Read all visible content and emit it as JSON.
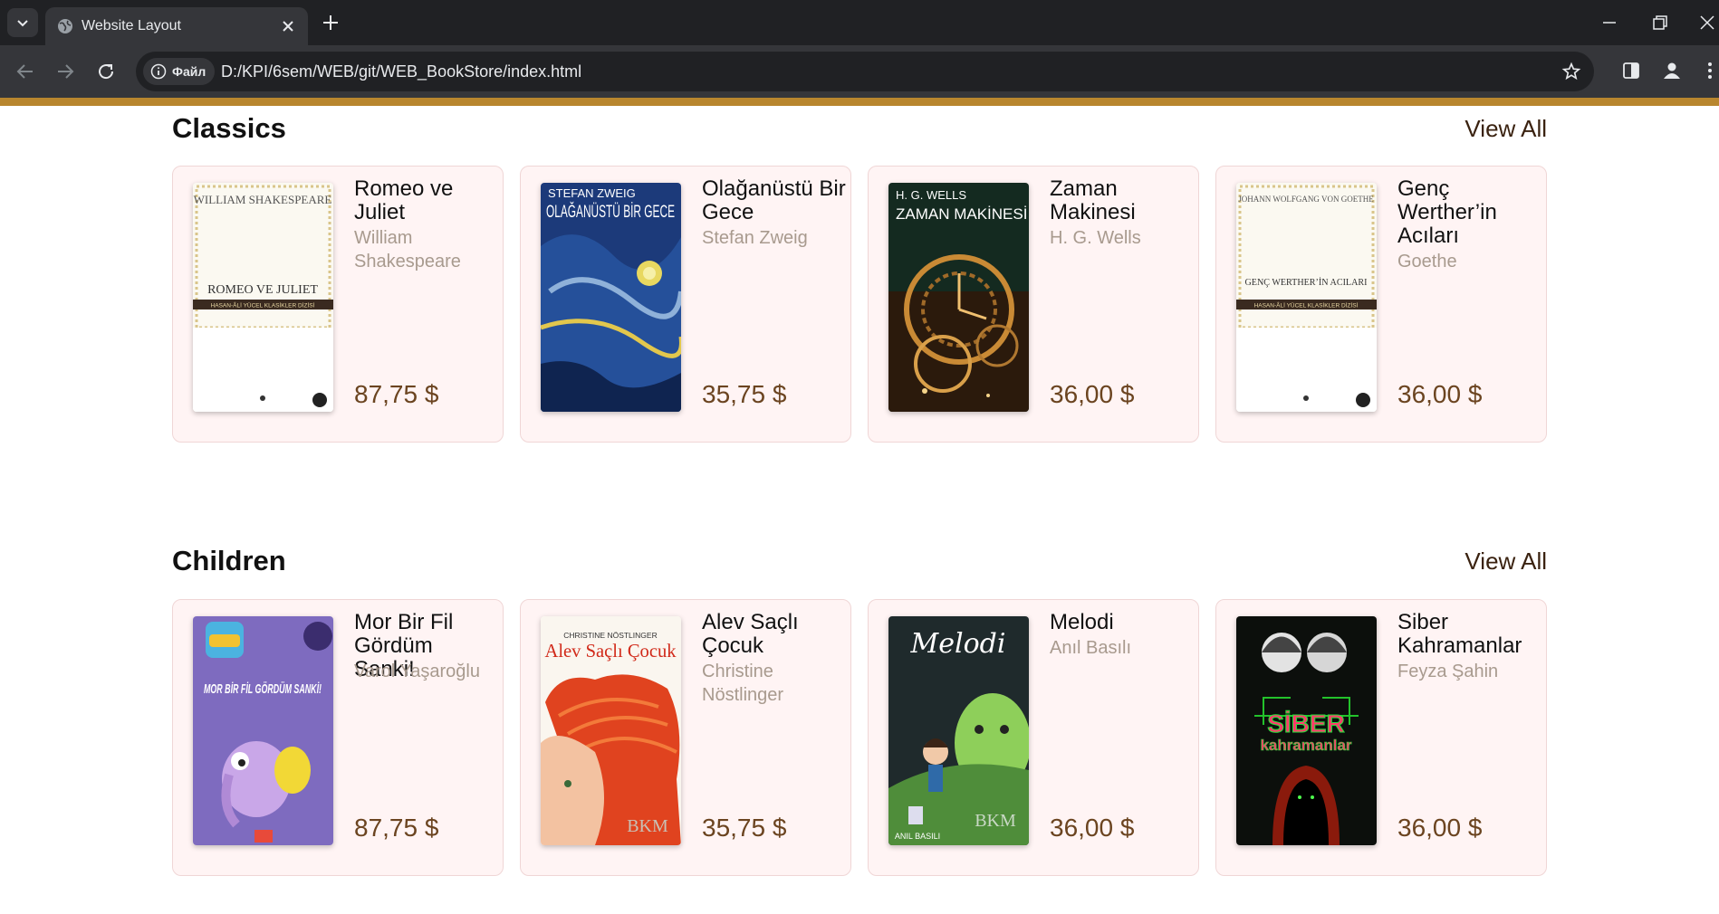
{
  "browser": {
    "tab_title": "Website Layout",
    "info_chip": "Файл",
    "url": "D:/KPI/6sem/WEB/git/WEB_BookStore/index.html"
  },
  "colors": {
    "accent": "#b8862e",
    "card_bg": "#fff4f4",
    "price": "#6b4420",
    "author": "#a89a8e"
  },
  "sections": [
    {
      "title": "Classics",
      "view_all": "View All",
      "books": [
        {
          "title": "Romeo ve Juliet",
          "author": "William Shakespeare",
          "price": "87,75 $"
        },
        {
          "title": "Olağanüstü Bir Gece",
          "author": "Stefan Zweig",
          "price": "35,75 $"
        },
        {
          "title": "Zaman Makinesi",
          "author": "H. G. Wells",
          "price": "36,00 $"
        },
        {
          "title": "Genç Werther’in Acıları",
          "author": "Goethe",
          "price": "36,00 $"
        }
      ]
    },
    {
      "title": "Children",
      "view_all": "View All",
      "books": [
        {
          "title": "Mor Bir Fil Gördüm Sanki!",
          "author": "Varol Yaşaroğlu",
          "price": "87,75 $"
        },
        {
          "title": "Alev Saçlı Çocuk",
          "author": "Christine Nöstlinger",
          "price": "35,75 $"
        },
        {
          "title": "Melodi",
          "author": "Anıl Basılı",
          "price": "36,00 $"
        },
        {
          "title": "Siber Kahramanlar",
          "author": "Feyza Şahin",
          "price": "36,00 $"
        }
      ]
    }
  ],
  "cover_text": {
    "romeo": {
      "author": "WILLIAM SHAKESPEARE",
      "title": "ROMEO VE JULIET",
      "band": "HASAN-ÂLİ YÜCEL KLASİKLER DİZİSİ"
    },
    "zweig": {
      "author": "STEFAN ZWEIG",
      "title": "OLAĞANÜSTÜ BİR GECE"
    },
    "wells": {
      "author": "H. G. WELLS",
      "title": "ZAMAN MAKİNESİ"
    },
    "goethe": {
      "author": "JOHANN WOLFGANG VON GOETHE",
      "title": "GENÇ WERTHER’İN ACILARI",
      "band": "HASAN-ÂLİ YÜCEL KLASİKLER DİZİSİ"
    },
    "mor": {
      "title": "MOR BİR FİL GÖRDÜM SANKİ!"
    },
    "alev": {
      "author": "CHRISTINE NÖSTLINGER",
      "title": "Alev Saçlı Çocuk",
      "logo": "BKM"
    },
    "melodi": {
      "title": "Melodi",
      "author": "ANIL BASILI",
      "logo": "BKM"
    },
    "siber": {
      "title": "SİBER",
      "subtitle": "kahramanlar"
    }
  }
}
